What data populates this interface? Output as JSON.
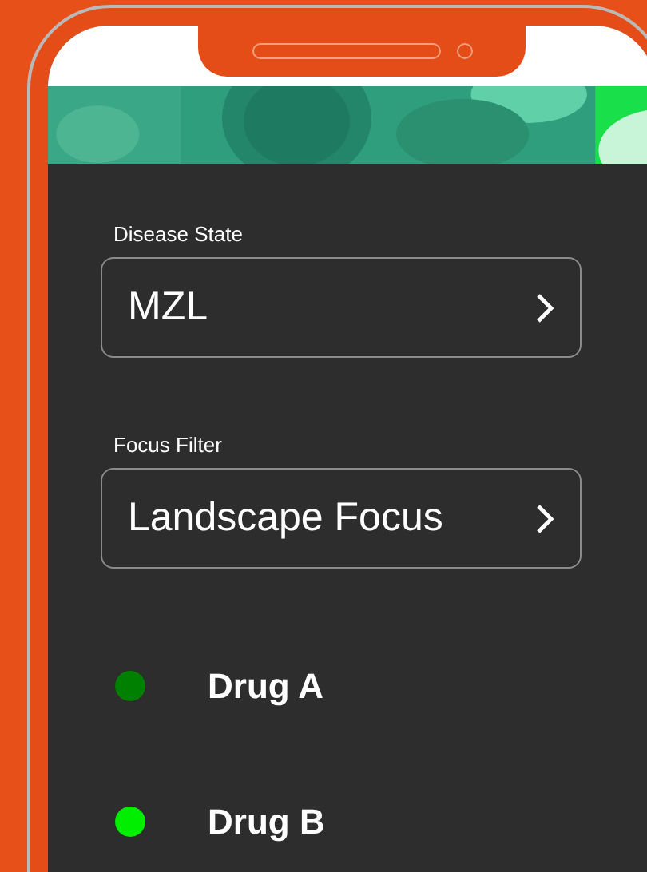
{
  "filters": [
    {
      "label": "Disease State",
      "value": "MZL"
    },
    {
      "label": "Focus Filter",
      "value": "Landscape Focus"
    }
  ],
  "legend": [
    {
      "name": "Drug A",
      "color": "#008000"
    },
    {
      "name": "Drug B",
      "color": "#00ee00"
    }
  ]
}
